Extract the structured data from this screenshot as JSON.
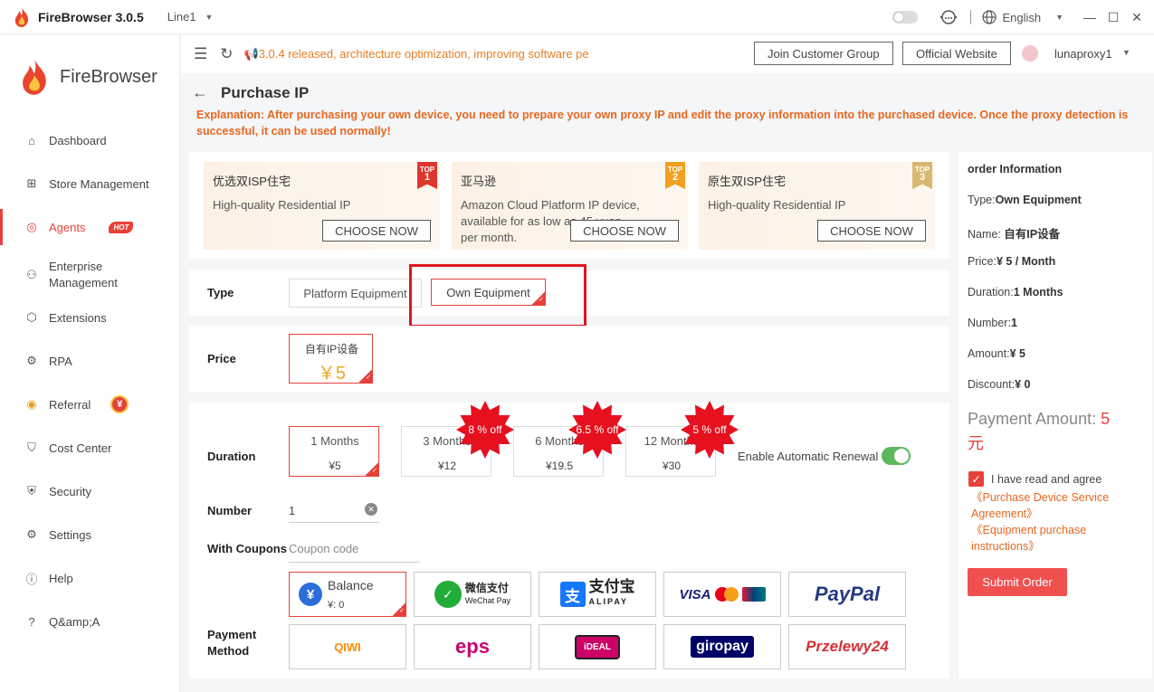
{
  "titlebar": {
    "app_name": "FireBrowser 3.0.5",
    "line": "Line1",
    "language": "English"
  },
  "sidebar": {
    "brand": "FireBrowser",
    "items": [
      {
        "label": "Dashboard"
      },
      {
        "label": "Store Management"
      },
      {
        "label": "Agents",
        "badge": "HOT"
      },
      {
        "label": "Enterprise Management"
      },
      {
        "label": "Extensions"
      },
      {
        "label": "RPA"
      },
      {
        "label": "Referral",
        "badge": "¥"
      },
      {
        "label": "Cost Center"
      },
      {
        "label": "Security"
      },
      {
        "label": "Settings"
      },
      {
        "label": "Help"
      },
      {
        "label": "Q&amp;A"
      }
    ]
  },
  "topbar": {
    "notice": "3.0.4 released, architecture optimization, improving software pe",
    "join_group": "Join Customer Group",
    "official_site": "Official Website",
    "username": "lunaproxy1"
  },
  "page": {
    "title": "Purchase IP",
    "explanation": "Explanation: After purchasing your own device, you need to prepare your own proxy IP and edit the proxy information into the purchased device. Once the proxy detection is successful, it can be used normally!"
  },
  "cards": [
    {
      "title": "优选双ISP住宅",
      "desc": "High-quality Residential IP",
      "button": "CHOOSE NOW",
      "ribbon_top": "TOP",
      "ribbon_num": "1",
      "color": "#e0352b"
    },
    {
      "title": "亚马逊",
      "desc": "Amazon Cloud Platform IP device, available for as low as 45 yuan per month.",
      "button": "CHOOSE NOW",
      "ribbon_top": "TOP",
      "ribbon_num": "2",
      "color": "#f0a020"
    },
    {
      "title": "原生双ISP住宅",
      "desc": "High-quality Residential IP",
      "button": "CHOOSE NOW",
      "ribbon_top": "TOP",
      "ribbon_num": "3",
      "color": "#d8b870"
    }
  ],
  "type": {
    "label": "Type",
    "options": [
      "Platform Equipment",
      "Own Equipment"
    ],
    "selected": "Own Equipment"
  },
  "price": {
    "label": "Price",
    "name": "自有IP设备",
    "value": "￥5"
  },
  "duration": {
    "label": "Duration",
    "options": [
      {
        "months": "1 Months",
        "price": "¥5",
        "discount": ""
      },
      {
        "months": "3 Months",
        "price": "¥12",
        "discount": "8 % off"
      },
      {
        "months": "6 Months",
        "price": "¥19.5",
        "discount": "6.5 % off"
      },
      {
        "months": "12 Months",
        "price": "¥30",
        "discount": "5 % off"
      }
    ],
    "renew_label": "Enable Automatic Renewal",
    "renew_on": true
  },
  "number": {
    "label": "Number",
    "value": "1"
  },
  "coupons": {
    "label": "With Coupons",
    "placeholder": "Coupon code"
  },
  "payment": {
    "label": "Payment Method",
    "balance_label": "Balance",
    "balance_value": "¥: 0",
    "methods": [
      "微信支付",
      "支付宝",
      "VISA",
      "PayPal",
      "QIWI",
      "eps",
      "iDEAL",
      "giropay",
      "Przelewy24"
    ],
    "wechat_sub": "WeChat Pay",
    "alipay_sub": "ALIPAY"
  },
  "order": {
    "title": "order Information",
    "type_label": "Type:",
    "type_value": "Own Equipment",
    "name_label": "Name: ",
    "name_value": "自有IP设备",
    "price_label": "Price:",
    "price_value": "¥ 5 / Month",
    "duration_label": "Duration:",
    "duration_value": "1 Months",
    "number_label": "Number:",
    "number_value": "1",
    "amount_label": "Amount:",
    "amount_value": "¥ 5",
    "discount_label": "Discount:",
    "discount_value": "¥ 0",
    "pay_label": "Payment Amount: ",
    "pay_value": "5",
    "pay_unit": "元",
    "agree": "I have read and agree",
    "link1a": "《Purchase Device Service",
    "link1b": "Agreement》",
    "link2a": "《Equipment purchase",
    "link2b": "instructions》",
    "submit": "Submit Order"
  }
}
